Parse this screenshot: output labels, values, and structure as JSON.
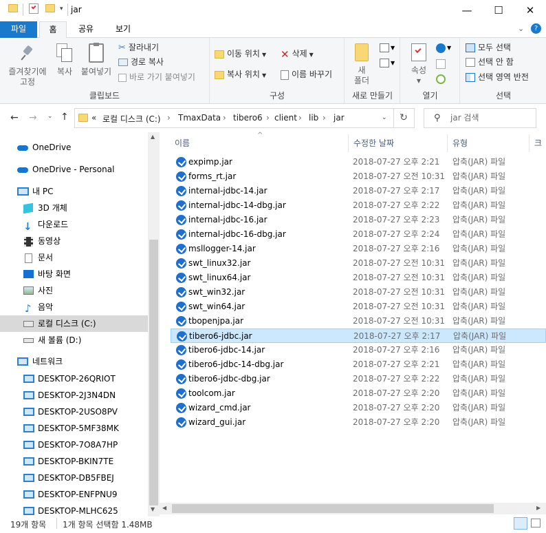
{
  "window": {
    "title": "jar",
    "minimize": "—",
    "maximize": "☐",
    "close": "✕"
  },
  "tabs": [
    {
      "label": "파일"
    },
    {
      "label": "홈"
    },
    {
      "label": "공유"
    },
    {
      "label": "보기"
    }
  ],
  "ribbon": {
    "clipboard": {
      "pin": "즐겨찾기에",
      "pin2": "고정",
      "copy": "복사",
      "paste": "붙여넣기",
      "cut": "잘라내기",
      "copy_path": "경로 복사",
      "paste_shortcut": "바로 가기 붙여넣기",
      "label": "클립보드"
    },
    "organize": {
      "move_to": "이동 위치",
      "copy_to": "복사 위치",
      "delete": "삭제",
      "rename": "이름 바꾸기",
      "label": "구성"
    },
    "new": {
      "new_folder": "새",
      "new_folder2": "폴더",
      "label": "새로 만들기"
    },
    "open": {
      "properties": "속성",
      "label": "열기"
    },
    "select": {
      "select_all": "모두 선택",
      "select_none": "선택 안 함",
      "invert": "선택 영역 반전",
      "label": "선택"
    }
  },
  "address": {
    "prefix": "«",
    "crumbs": [
      "로컬 디스크 (C:)",
      "TmaxData",
      "tibero6",
      "client",
      "lib",
      "jar"
    ],
    "search_placeholder": "jar 검색"
  },
  "nav": {
    "onedrive": "OneDrive",
    "onedrive_personal": "OneDrive - Personal",
    "this_pc": "내 PC",
    "objects3d": "3D 개체",
    "downloads": "다운로드",
    "videos": "동영상",
    "documents": "문서",
    "desktop": "바탕 화면",
    "pictures": "사진",
    "music": "음악",
    "local_disk": "로컬 디스크 (C:)",
    "new_volume": "새 볼륨 (D:)",
    "network": "네트워크",
    "computers": [
      "DESKTOP-26QRIOT",
      "DESKTOP-2J3N4DN",
      "DESKTOP-2USO8PV",
      "DESKTOP-5MF38MK",
      "DESKTOP-7O8A7HP",
      "DESKTOP-BKIN7TE",
      "DESKTOP-DB5FBEJ",
      "DESKTOP-ENFPNU9",
      "DESKTOP-MLHC625"
    ]
  },
  "columns": {
    "name": "이름",
    "date": "수정한 날짜",
    "type": "유형",
    "size": "크"
  },
  "files": [
    {
      "name": "expimp.jar",
      "date": "2018-07-27 오후 2:21",
      "type": "압축(JAR) 파일"
    },
    {
      "name": "forms_rt.jar",
      "date": "2018-07-27 오전 10:31",
      "type": "압축(JAR) 파일"
    },
    {
      "name": "internal-jdbc-14.jar",
      "date": "2018-07-27 오후 2:17",
      "type": "압축(JAR) 파일"
    },
    {
      "name": "internal-jdbc-14-dbg.jar",
      "date": "2018-07-27 오후 2:22",
      "type": "압축(JAR) 파일"
    },
    {
      "name": "internal-jdbc-16.jar",
      "date": "2018-07-27 오후 2:23",
      "type": "압축(JAR) 파일"
    },
    {
      "name": "internal-jdbc-16-dbg.jar",
      "date": "2018-07-27 오후 2:24",
      "type": "압축(JAR) 파일"
    },
    {
      "name": "msllogger-14.jar",
      "date": "2018-07-27 오후 2:16",
      "type": "압축(JAR) 파일"
    },
    {
      "name": "swt_linux32.jar",
      "date": "2018-07-27 오전 10:31",
      "type": "압축(JAR) 파일"
    },
    {
      "name": "swt_linux64.jar",
      "date": "2018-07-27 오전 10:31",
      "type": "압축(JAR) 파일"
    },
    {
      "name": "swt_win32.jar",
      "date": "2018-07-27 오전 10:31",
      "type": "압축(JAR) 파일"
    },
    {
      "name": "swt_win64.jar",
      "date": "2018-07-27 오전 10:31",
      "type": "압축(JAR) 파일"
    },
    {
      "name": "tbopenjpa.jar",
      "date": "2018-07-27 오전 10:31",
      "type": "압축(JAR) 파일"
    },
    {
      "name": "tibero6-jdbc.jar",
      "date": "2018-07-27 오후 2:17",
      "type": "압축(JAR) 파일"
    },
    {
      "name": "tibero6-jdbc-14.jar",
      "date": "2018-07-27 오후 2:16",
      "type": "압축(JAR) 파일"
    },
    {
      "name": "tibero6-jdbc-14-dbg.jar",
      "date": "2018-07-27 오후 2:21",
      "type": "압축(JAR) 파일"
    },
    {
      "name": "tibero6-jdbc-dbg.jar",
      "date": "2018-07-27 오후 2:22",
      "type": "압축(JAR) 파일"
    },
    {
      "name": "toolcom.jar",
      "date": "2018-07-27 오후 2:20",
      "type": "압축(JAR) 파일"
    },
    {
      "name": "wizard_cmd.jar",
      "date": "2018-07-27 오후 2:20",
      "type": "압축(JAR) 파일"
    },
    {
      "name": "wizard_gui.jar",
      "date": "2018-07-27 오후 2:20",
      "type": "압축(JAR) 파일"
    }
  ],
  "selected_file": "tibero6-jdbc.jar",
  "status": {
    "count": "19개 항목",
    "selection": "1개 항목 선택함 1.48MB"
  },
  "colors": {
    "accent": "#1979ca",
    "selection": "#cce8ff",
    "jar_icon": "#1f6fcf"
  }
}
